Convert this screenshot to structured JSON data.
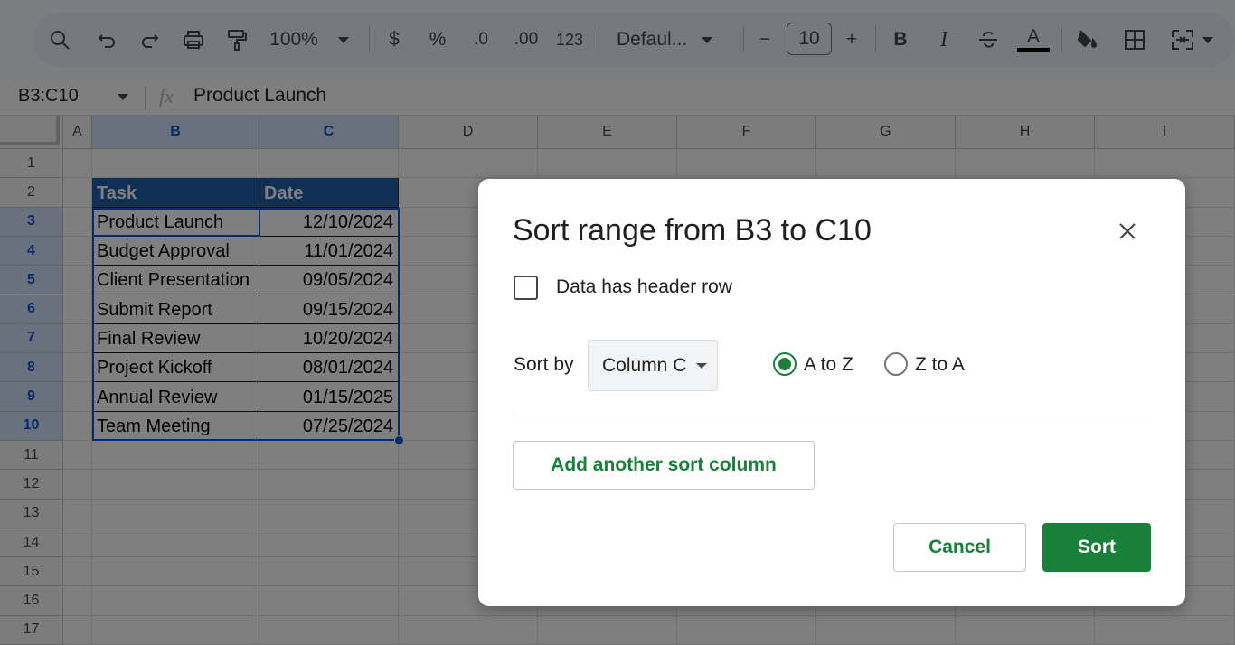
{
  "toolbar": {
    "zoom": "100%",
    "currency": "$",
    "percent": "%",
    "decrease_decimal": ".0",
    "increase_decimal": ".00",
    "number_format": "123",
    "font_name": "Defaul...",
    "font_size": "10",
    "minus": "−",
    "plus": "+",
    "bold": "B",
    "italic": "I",
    "text_color_letter": "A",
    "text_color": "#000000"
  },
  "formula_bar": {
    "name_box": "B3:C10",
    "fx": "fx",
    "value": "Product Launch"
  },
  "columns": [
    "A",
    "B",
    "C",
    "D",
    "E",
    "F",
    "G",
    "H",
    "I"
  ],
  "rows": [
    "1",
    "2",
    "3",
    "4",
    "5",
    "6",
    "7",
    "8",
    "9",
    "10",
    "11",
    "12",
    "13",
    "14",
    "15",
    "16",
    "17"
  ],
  "table": {
    "headers": [
      "Task",
      "Date"
    ],
    "rows": [
      [
        "Product Launch",
        "12/10/2024"
      ],
      [
        "Budget Approval",
        "11/01/2024"
      ],
      [
        "Client Presentation",
        "09/05/2024"
      ],
      [
        "Submit Report",
        "09/15/2024"
      ],
      [
        "Final Review",
        "10/20/2024"
      ],
      [
        "Project Kickoff",
        "08/01/2024"
      ],
      [
        "Annual Review",
        "01/15/2025"
      ],
      [
        "Team Meeting",
        "07/25/2024"
      ]
    ]
  },
  "dialog": {
    "title": "Sort range from B3 to C10",
    "header_row_label": "Data has header row",
    "header_row_checked": false,
    "sort_by_label": "Sort by",
    "sort_column": "Column C",
    "asc_label": "A to Z",
    "desc_label": "Z to A",
    "selected_order": "A to Z",
    "add_column_label": "Add another sort column",
    "cancel_label": "Cancel",
    "sort_label": "Sort"
  },
  "colors": {
    "accent_green": "#188038",
    "header_fill": "#1e5eaa",
    "selection_blue": "#0b57d0"
  }
}
